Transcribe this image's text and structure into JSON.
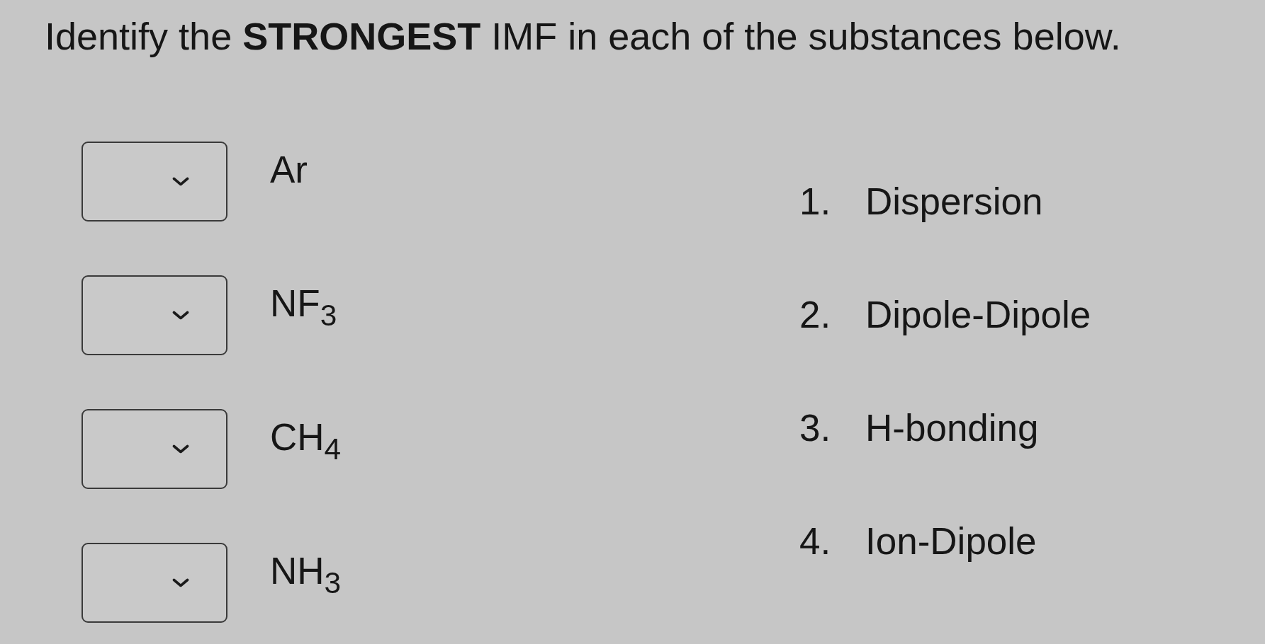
{
  "instruction": "Identify the **STRONGEST** IMF in each of the substances below.",
  "substances": [
    {
      "formula": "Ar"
    },
    {
      "formula": "NF$_{3}$"
    },
    {
      "formula": "CH$_{4}$"
    },
    {
      "formula": "NH$_{3}$"
    }
  ],
  "options": [
    {
      "number": "1.",
      "label": "Dispersion"
    },
    {
      "number": "2.",
      "label": "Dipole-Dipole"
    },
    {
      "number": "3.",
      "label": "H-bonding"
    },
    {
      "number": "4.",
      "label": "Ion-Dipole"
    }
  ]
}
